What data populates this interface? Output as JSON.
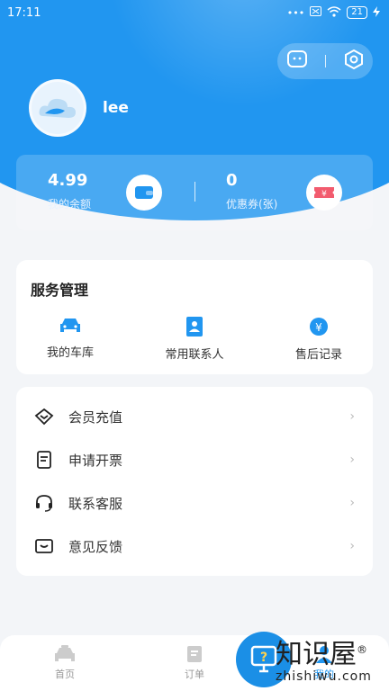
{
  "status": {
    "time": "17:11",
    "dots": "•••",
    "battery": "21"
  },
  "profile": {
    "username": "lee"
  },
  "balance": {
    "value": "4.99",
    "label": "我的余额"
  },
  "coupons": {
    "value": "0",
    "label": "优惠券(张)"
  },
  "services": {
    "title": "服务管理",
    "items": [
      {
        "label": "我的车库",
        "icon": "car-icon"
      },
      {
        "label": "常用联系人",
        "icon": "contact-book-icon"
      },
      {
        "label": "售后记录",
        "icon": "after-sales-icon"
      }
    ]
  },
  "menu": [
    {
      "label": "会员充值",
      "icon": "member-recharge-icon"
    },
    {
      "label": "申请开票",
      "icon": "invoice-icon"
    },
    {
      "label": "联系客服",
      "icon": "headset-icon"
    },
    {
      "label": "意见反馈",
      "icon": "feedback-icon"
    }
  ],
  "nav": [
    {
      "label": "首页",
      "icon": "car-home-icon"
    },
    {
      "label": "订单",
      "icon": "order-icon"
    },
    {
      "label": "我的",
      "icon": "profile-icon"
    }
  ],
  "watermark": {
    "title": "知识屋",
    "sub": "zhishiwu.com",
    "mark": "®"
  },
  "colors": {
    "primary": "#2196f0",
    "background": "#f3f5f8",
    "coupon": "#f25b6e"
  }
}
